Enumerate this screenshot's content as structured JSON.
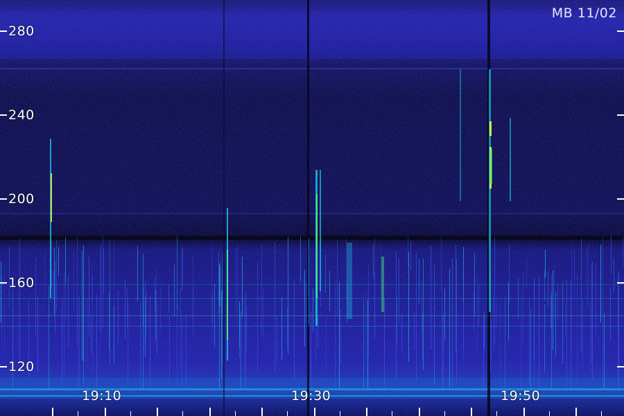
{
  "label": "MB 11/02",
  "y_axis": {
    "ticks": [
      "280",
      "240",
      "200",
      "160",
      "120"
    ],
    "values": [
      280,
      240,
      200,
      160,
      120
    ]
  },
  "x_axis": {
    "ticks": [
      "19:10",
      "19:30",
      "19:50"
    ]
  },
  "colors": {
    "background_low": "#0b0b38",
    "background_mid": "#1d1d96",
    "signal_cyan": "#19c8e6",
    "signal_green": "#4ef07a",
    "signal_yellow": "#e8f040"
  }
}
